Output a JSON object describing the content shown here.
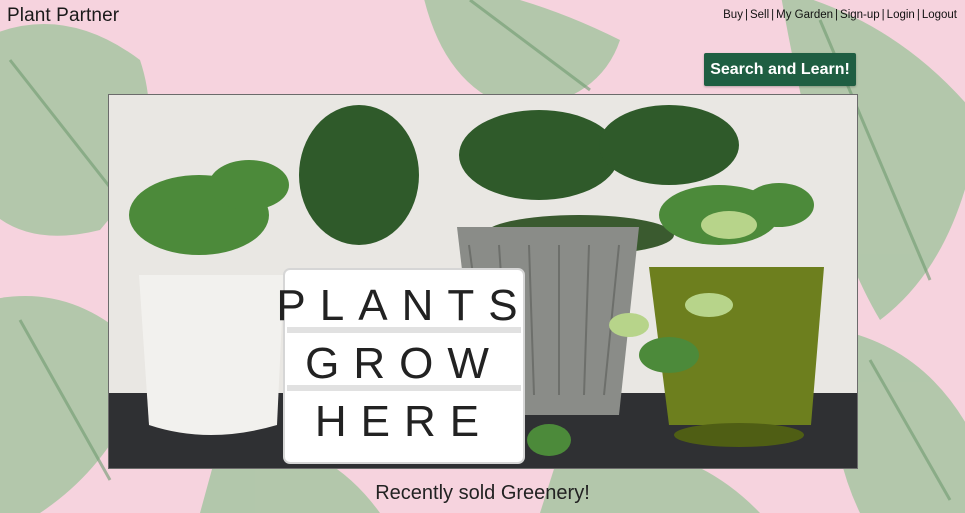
{
  "site": {
    "title": "Plant Partner"
  },
  "nav": {
    "items": [
      {
        "label": "Buy"
      },
      {
        "label": "Sell"
      },
      {
        "label": "My Garden"
      },
      {
        "label": "Sign-up"
      },
      {
        "label": "Login"
      },
      {
        "label": "Logout"
      }
    ],
    "separator": "|"
  },
  "search": {
    "button_label": "Search and Learn!"
  },
  "hero": {
    "lightbox_lines": [
      "PLANTS",
      "GROW",
      "HERE"
    ]
  },
  "section": {
    "recent_title": "Recently sold Greenery!"
  },
  "colors": {
    "background": "#f6d3de",
    "button": "#1f5e42",
    "leaf": "#8fb88f"
  }
}
